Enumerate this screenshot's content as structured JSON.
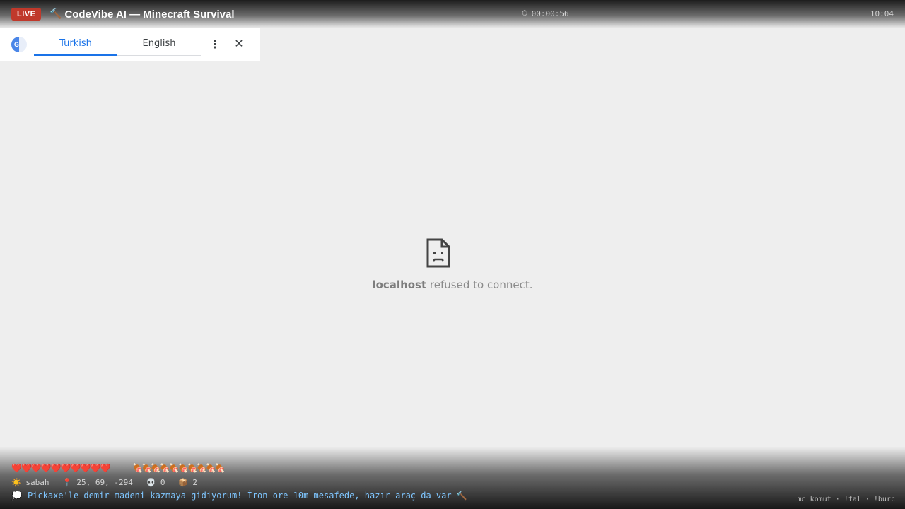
{
  "header": {
    "live_label": "LIVE",
    "title_icon": "🔨",
    "title": "CodeVibe AI — Minecraft Survival",
    "timer_icon": "⏱",
    "timer": "00:00:56",
    "clock": "10:04"
  },
  "translate_bar": {
    "logo_icon": "google-translate-icon",
    "tabs": [
      {
        "label": "Turkish",
        "active": true
      },
      {
        "label": "English",
        "active": false
      }
    ],
    "menu_glyph": "⋮",
    "close_glyph": "✕"
  },
  "error": {
    "icon": "sad-document-icon",
    "host": "localhost",
    "message": " refused to connect."
  },
  "hud": {
    "hearts": "❤️❤️❤️❤️❤️❤️❤️❤️❤️❤️",
    "food": "🍖🍖🍖🍖🍖🍖🍖🍖🍖🍖",
    "time_icon": "☀️",
    "time_of_day": "sabah",
    "coords_icon": "📍",
    "coords": "25, 69, -294",
    "deaths_icon": "💀",
    "deaths": "0",
    "items_icon": "📦",
    "items": "2",
    "chat_icon": "💭",
    "chat_message": "Pickaxe'le demir madeni kazmaya gidiyorum! İron ore 10m mesafede, hazır araç da var 🔨",
    "commands": "!mc komut · !fal · !burc"
  }
}
